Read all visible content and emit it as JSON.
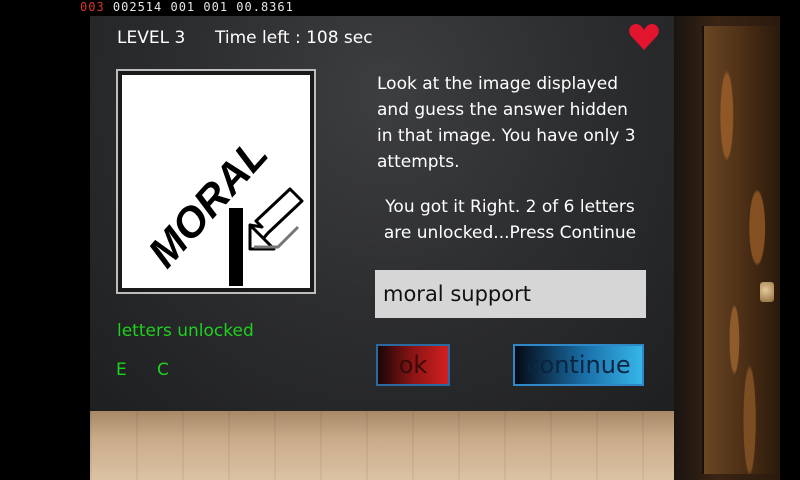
{
  "debug": {
    "prefix": "003",
    "rest": " 002514 001 001 00.8361"
  },
  "hud": {
    "level": "LEVEL 3",
    "time_left": "Time left :  108 sec",
    "lives_icon": "heart-icon",
    "accent_color": "#e3142e"
  },
  "puzzle": {
    "word": "MORAL",
    "arrow_icon": "arrow-pointing-left-down-icon"
  },
  "instructions": "Look at the image displayed and guess the answer hidden in that image. You have only 3 attempts.",
  "result_message": "You got it Right. 2 of 6 letters are unlocked...Press Continue",
  "answer": {
    "value": "moral support"
  },
  "letters_unlocked": {
    "title": "letters unlocked",
    "letters": [
      "E",
      "C"
    ]
  },
  "buttons": {
    "ok": "ok",
    "continue": "continue"
  }
}
